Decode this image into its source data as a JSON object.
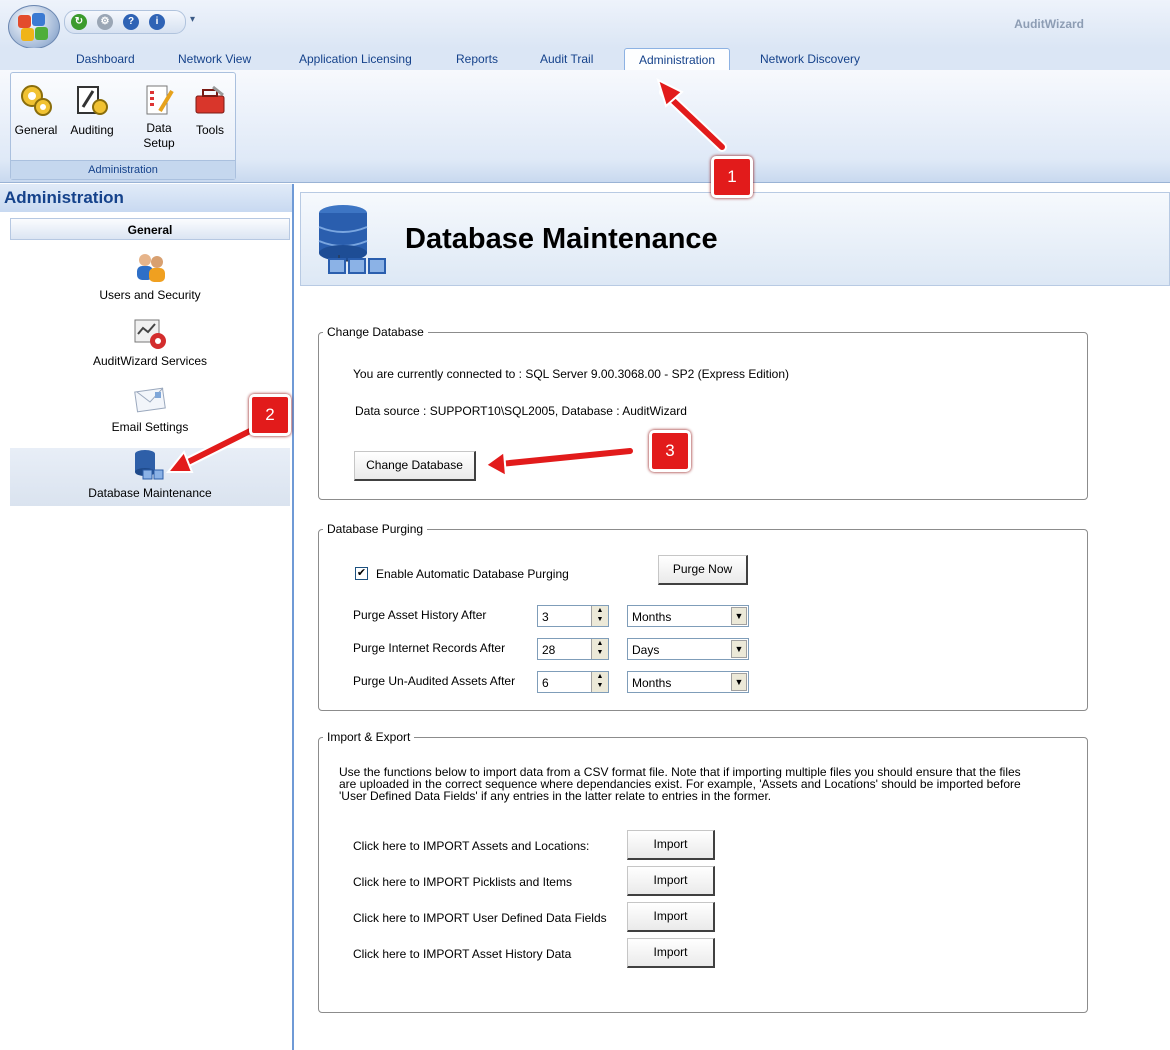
{
  "app": {
    "title": "AuditWizard"
  },
  "tabs": [
    {
      "label": "Dashboard"
    },
    {
      "label": "Network View"
    },
    {
      "label": "Application Licensing"
    },
    {
      "label": "Reports"
    },
    {
      "label": "Audit Trail"
    },
    {
      "label": "Administration",
      "active": true
    },
    {
      "label": "Network Discovery"
    }
  ],
  "ribbon": {
    "group_label": "Administration",
    "buttons": [
      {
        "label": "General",
        "icon": "gears-icon"
      },
      {
        "label": "Auditing",
        "icon": "auditing-icon"
      },
      {
        "label": "Data\nSetup",
        "icon": "notepad-icon"
      },
      {
        "label": "Tools",
        "icon": "toolbox-icon"
      }
    ]
  },
  "sidebar": {
    "title": "Administration",
    "section": "General",
    "items": [
      {
        "label": "Users and Security",
        "icon": "users-icon"
      },
      {
        "label": "AuditWizard Services",
        "icon": "services-icon"
      },
      {
        "label": "Email Settings",
        "icon": "email-icon"
      },
      {
        "label": "Database Maintenance",
        "icon": "database-icon",
        "selected": true
      }
    ]
  },
  "page": {
    "title": "Database Maintenance"
  },
  "change_db": {
    "legend": "Change Database",
    "connected_text": "You are currently connected to : SQL Server 9.00.3068.00 - SP2 (Express Edition)",
    "datasource_text": "Data source : SUPPORT10\\SQL2005, Database : AuditWizard",
    "button": "Change Database"
  },
  "purging": {
    "legend": "Database Purging",
    "enable_label": "Enable Automatic Database Purging",
    "enabled": true,
    "purge_now": "Purge Now",
    "rows": [
      {
        "label": "Purge Asset History After",
        "value": "3",
        "unit": "Months"
      },
      {
        "label": "Purge Internet Records After",
        "value": "28",
        "unit": "Days"
      },
      {
        "label": "Purge Un-Audited Assets After",
        "value": "6",
        "unit": "Months"
      }
    ]
  },
  "import_export": {
    "legend": "Import & Export",
    "desc_lines": [
      "Use the functions below to import data  from a CSV format file.  Note that if importing multiple files you should ensure that the files",
      "are uploaded in the correct sequence where dependancies exist.  For example, 'Assets and Locations' should be imported before",
      "'User Defined Data Fields' if any entries in the latter relate to entries in the former."
    ],
    "rows": [
      {
        "label": "Click here to IMPORT Assets and Locations:",
        "button": "Import"
      },
      {
        "label": "Click here to IMPORT Picklists and Items",
        "button": "Import"
      },
      {
        "label": "Click here to IMPORT User Defined Data Fields",
        "button": "Import"
      },
      {
        "label": "Click here to IMPORT Asset History Data",
        "button": "Import"
      }
    ]
  },
  "annotations": [
    {
      "label": "1"
    },
    {
      "label": "2"
    },
    {
      "label": "3"
    }
  ],
  "colors": {
    "accent": "#15428b",
    "callout": "#e21b1b"
  }
}
